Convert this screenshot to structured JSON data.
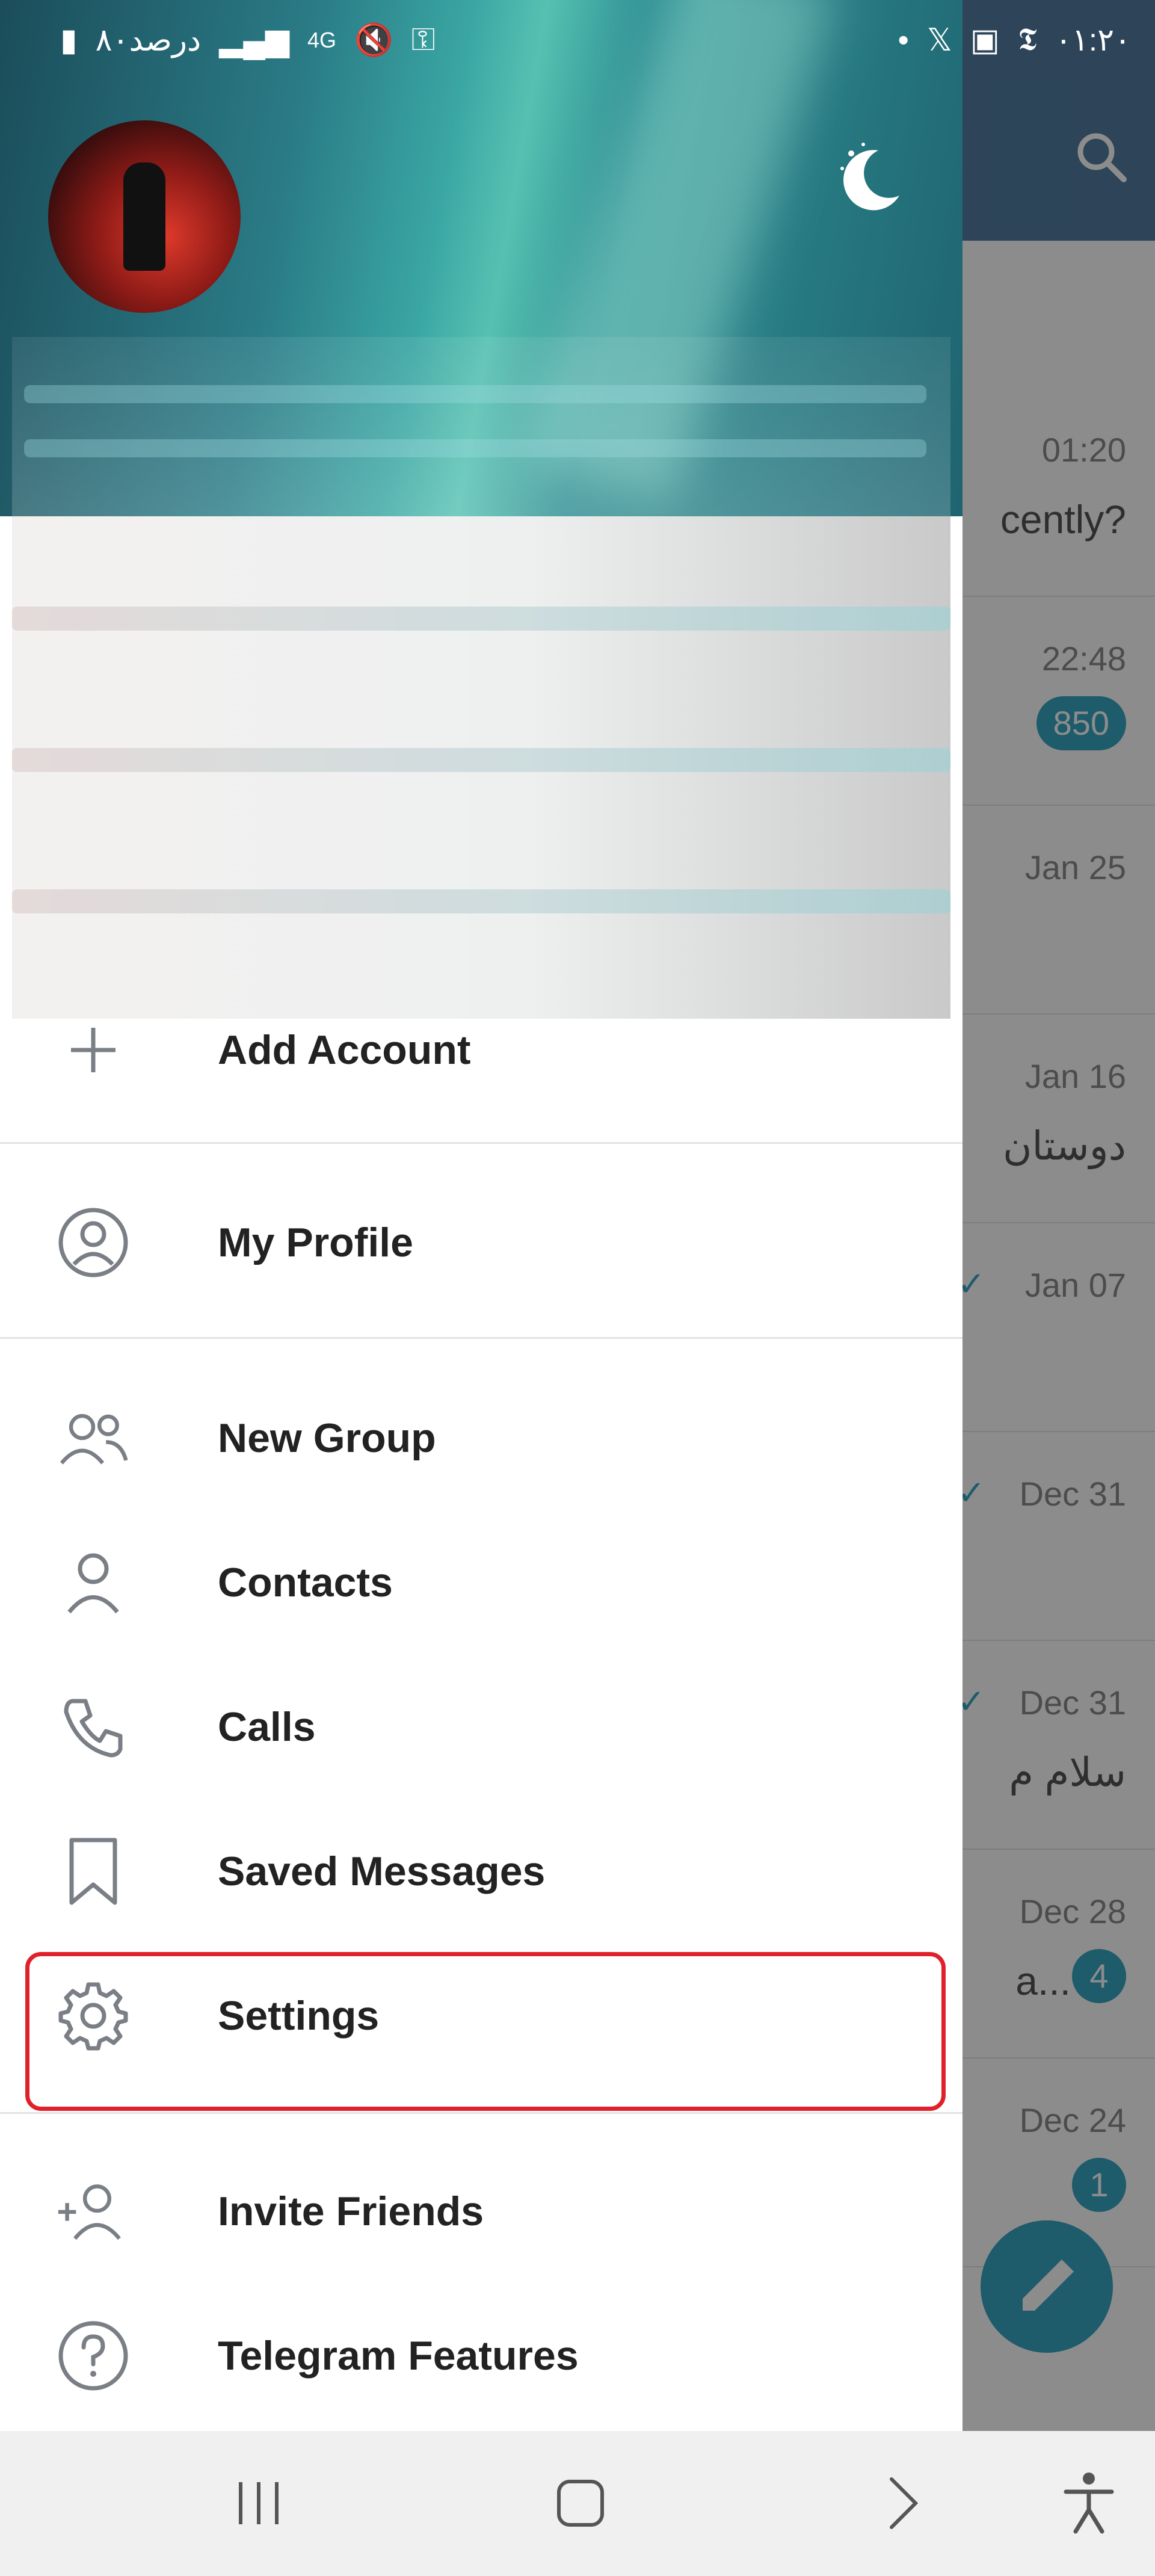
{
  "status_bar": {
    "left_text": "۸۰درصد",
    "network": "4G",
    "time": "۰۱:۲۰"
  },
  "drawer": {
    "menu": [
      {
        "id": "add-account",
        "label": "Add Account",
        "icon": "plus-icon"
      },
      {
        "id": "my-profile",
        "label": "My Profile",
        "icon": "profile-icon"
      },
      {
        "id": "new-group",
        "label": "New Group",
        "icon": "group-icon"
      },
      {
        "id": "contacts",
        "label": "Contacts",
        "icon": "contact-icon"
      },
      {
        "id": "calls",
        "label": "Calls",
        "icon": "phone-icon"
      },
      {
        "id": "saved-messages",
        "label": "Saved Messages",
        "icon": "bookmark-icon"
      },
      {
        "id": "settings",
        "label": "Settings",
        "icon": "gear-icon",
        "highlighted": true
      },
      {
        "id": "invite-friends",
        "label": "Invite Friends",
        "icon": "add-user-icon"
      },
      {
        "id": "telegram-features",
        "label": "Telegram Features",
        "icon": "question-icon"
      }
    ]
  },
  "background_chats": {
    "banner_snippet": "cently?",
    "rows": [
      {
        "time": "01:20",
        "snippet": "cently?",
        "badge": ""
      },
      {
        "time": "22:48",
        "snippet": "",
        "badge": "850"
      },
      {
        "time": "Jan 25",
        "snippet": "",
        "badge": ""
      },
      {
        "time": "Jan 16",
        "snippet": "دوستان",
        "badge": ""
      },
      {
        "time": "Jan 07",
        "snippet": "",
        "badge": "",
        "read": true
      },
      {
        "time": "Dec 31",
        "snippet": "",
        "badge": "",
        "read": true
      },
      {
        "time": "Dec 31",
        "snippet": "سلام م",
        "badge": "",
        "read": true
      },
      {
        "time": "Dec 28",
        "snippet": "a...",
        "badge": "4"
      },
      {
        "time": "Dec 24",
        "snippet": "",
        "badge": "1"
      }
    ]
  },
  "colors": {
    "accent": "#37a6c4",
    "highlight_border": "#e0212b",
    "header_bg": "#2a7b86"
  }
}
